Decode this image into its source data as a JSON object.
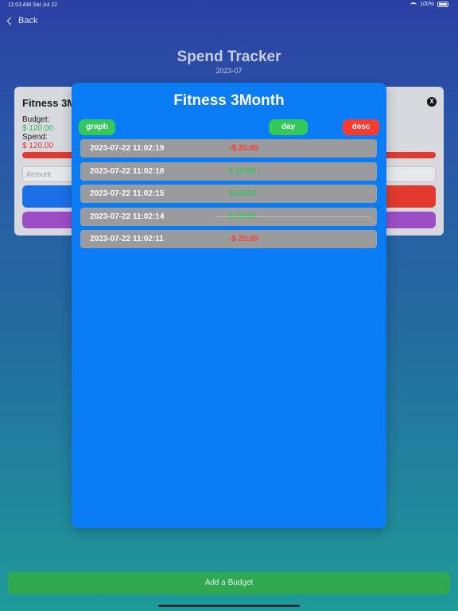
{
  "status_bar": {
    "time_date": "11:03 AM   Sat Jul 22",
    "battery": "100%"
  },
  "nav": {
    "back_label": "Back"
  },
  "header": {
    "title": "Spend Tracker",
    "subtitle": "2023-07"
  },
  "background_card": {
    "title": "Fitness 3Month",
    "budget_label": "Budget:",
    "budget_value": "$ 120.00",
    "spend_label": "Spend:",
    "spend_value": "$ 120.00",
    "amount_placeholder": "Amount",
    "close_label": "X"
  },
  "modal": {
    "title": "Fitness 3Month",
    "graph_label": "graph",
    "day_label": "day",
    "desc_label": "desc",
    "transactions": [
      {
        "timestamp": "2023-07-22 11:02:19",
        "amount": "-$ 20.00",
        "sign": "negative"
      },
      {
        "timestamp": "2023-07-22 11:02:18",
        "amount": "$ 20.00",
        "sign": "positive"
      },
      {
        "timestamp": "2023-07-22 11:02:15",
        "amount": "$ 20.00",
        "sign": "positive"
      },
      {
        "timestamp": "2023-07-22 11:02:14",
        "amount": "$ 20.00",
        "sign": "positive"
      },
      {
        "timestamp": "2023-07-22 11:02:11",
        "amount": "-$ 20.00",
        "sign": "negative"
      }
    ]
  },
  "footer": {
    "add_budget_label": "Add a Budget"
  },
  "colors": {
    "modal_bg": "#0a7cf6",
    "positive": "#34c759",
    "negative": "#ff3b30",
    "row_bg": "#9b9b9e"
  }
}
